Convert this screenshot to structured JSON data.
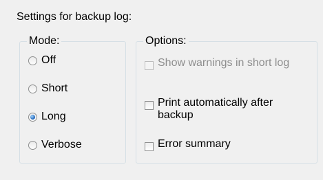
{
  "panel": {
    "title": "Settings for backup log:"
  },
  "mode": {
    "legend": "Mode:",
    "options": [
      {
        "label": "Off",
        "checked": false
      },
      {
        "label": "Short",
        "checked": false
      },
      {
        "label": "Long",
        "checked": true
      },
      {
        "label": "Verbose",
        "checked": false
      }
    ]
  },
  "options": {
    "legend": "Options:",
    "items": [
      {
        "label": "Show warnings in short log",
        "checked": false,
        "enabled": false
      },
      {
        "label": "Print automatically after backup",
        "checked": false,
        "enabled": true
      },
      {
        "label": "Error summary",
        "checked": false,
        "enabled": true
      }
    ]
  }
}
